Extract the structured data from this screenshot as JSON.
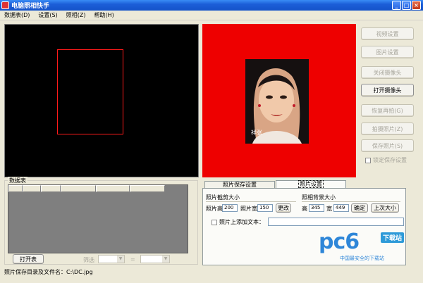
{
  "window": {
    "title": "电脑照相快手",
    "minimize_glyph": "_",
    "maximize_glyph": "□",
    "close_glyph": "×"
  },
  "menu": {
    "items": [
      "数据表(D)",
      "设置(S)",
      "照相(Z)",
      "帮助(H)"
    ]
  },
  "preview": {
    "name_label": "祥张",
    "background_color": "#ee0000"
  },
  "side_buttons": {
    "video_settings": "视频设置",
    "image_settings": "图片设置",
    "close_camera": "关闭摄像头",
    "open_camera": "打开摄像头",
    "resume_shooting": "恢复再拍(G)",
    "capture_photo": "拍摄照片(Z)",
    "save_photo": "保存照片(S)",
    "lock_save_settings": "锁定保存设置"
  },
  "data_table": {
    "group_label": "数据表",
    "open_button": "打开表",
    "filter_label": "筛选",
    "equals_label": "=",
    "column_headers": [
      "",
      "",
      "",
      "",
      "",
      ""
    ]
  },
  "tabs": {
    "photo_save": "照片保存设置",
    "photo_settings": "照片设置",
    "active": "photo_settings"
  },
  "photo_settings": {
    "crop_size_title": "照片截剪大小",
    "height_label": "照片高",
    "height_value": "200",
    "width_label": "照片宽",
    "width_value": "150",
    "change_button": "更改",
    "bg_size_title": "照相背景大小",
    "bg_height_label": "高",
    "bg_height_value": "345",
    "bg_width_label": "宽",
    "bg_width_value": "449",
    "confirm_button": "确定",
    "last_size_button": "上次大小",
    "add_text_label": "照片上添加文本："
  },
  "status": {
    "save_path": "照片保存目录及文件名：C:\\DC.jpg"
  },
  "watermark": {
    "logo": "pc6",
    "badge": "下载站",
    "tagline": "中国最安全的下载站"
  }
}
